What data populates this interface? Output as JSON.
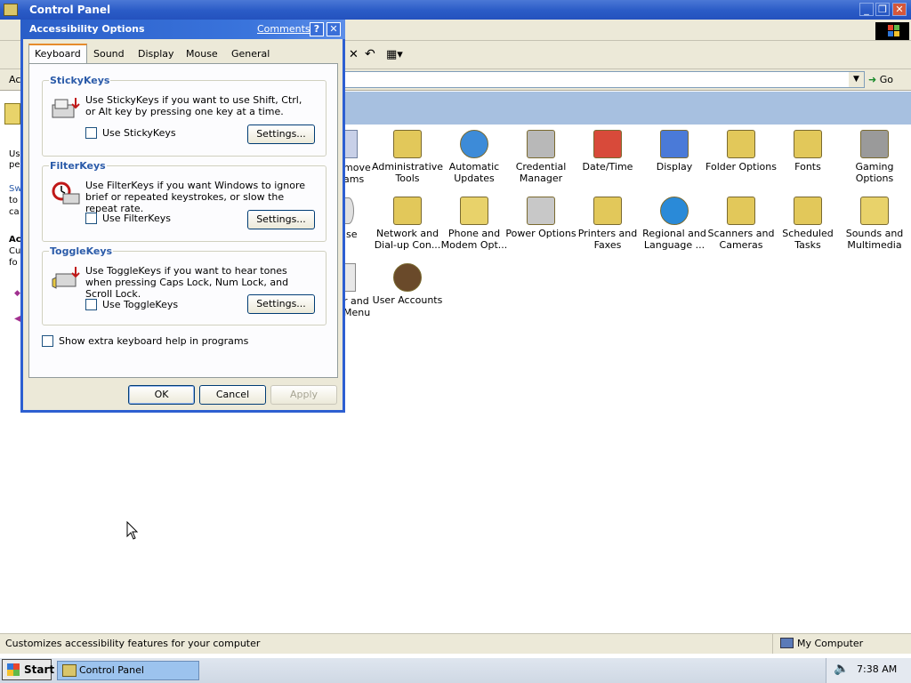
{
  "window": {
    "title": "Control Panel",
    "minimize": "_",
    "restore": "❐",
    "close": "✕"
  },
  "address": {
    "label": "Ac",
    "go": "Go",
    "dropdown": "▼"
  },
  "left_pane": {
    "lines": [
      "Us",
      "pe",
      "Sw",
      "to",
      "ca",
      "Ac",
      "Cu",
      "fo"
    ]
  },
  "partial_icons": {
    "row1": [
      "move",
      "ams"
    ],
    "row2": "se",
    "row3": [
      "r and",
      "Menu"
    ]
  },
  "icons": [
    {
      "label": "Administrative Tools",
      "icon": "admin-tools-icon"
    },
    {
      "label": "Automatic Updates",
      "icon": "globe-update-icon"
    },
    {
      "label": "Credential Manager",
      "icon": "keys-icon"
    },
    {
      "label": "Date/Time",
      "icon": "calendar-clock-icon"
    },
    {
      "label": "Display",
      "icon": "monitor-icon"
    },
    {
      "label": "Folder Options",
      "icon": "folder-options-icon"
    },
    {
      "label": "Fonts",
      "icon": "fonts-folder-icon"
    },
    {
      "label": "Gaming Options",
      "icon": "joystick-icon"
    },
    {
      "label": "Network and Dial-up Con...",
      "icon": "network-icon"
    },
    {
      "label": "Phone and Modem Opt...",
      "icon": "phone-icon"
    },
    {
      "label": "Power Options",
      "icon": "power-plug-icon"
    },
    {
      "label": "Printers and Faxes",
      "icon": "printer-folder-icon"
    },
    {
      "label": "Regional and Language ...",
      "icon": "globe-icon"
    },
    {
      "label": "Scanners and Cameras",
      "icon": "scanner-folder-icon"
    },
    {
      "label": "Scheduled Tasks",
      "icon": "tasks-folder-icon"
    },
    {
      "label": "Sounds and Multimedia",
      "icon": "speaker-icon"
    },
    {
      "label": "User Accounts",
      "icon": "user-icon"
    }
  ],
  "dialog": {
    "title": "Accessibility Options",
    "comments_link": "Comments?",
    "help": "?",
    "close": "✕",
    "tabs": [
      "Keyboard",
      "Sound",
      "Display",
      "Mouse",
      "General"
    ],
    "active_tab": "Keyboard",
    "groups": [
      {
        "label": "StickyKeys",
        "description": "Use StickyKeys if you want to use Shift, Ctrl, or Alt key by pressing one key at a time.",
        "checkbox": "Use StickyKeys",
        "checked": false,
        "settings": "Settings..."
      },
      {
        "label": "FilterKeys",
        "description": "Use FilterKeys if you want Windows to ignore brief or repeated keystrokes, or slow the repeat rate.",
        "checkbox": "Use FilterKeys",
        "checked": false,
        "settings": "Settings..."
      },
      {
        "label": "ToggleKeys",
        "description": "Use ToggleKeys if you want to hear tones when pressing Caps Lock, Num Lock, and Scroll Lock.",
        "checkbox": "Use ToggleKeys",
        "checked": false,
        "settings": "Settings..."
      }
    ],
    "extra_help": "Show extra keyboard help in programs",
    "buttons": {
      "ok": "OK",
      "cancel": "Cancel",
      "apply": "Apply"
    }
  },
  "status": {
    "text": "Customizes accessibility features for your computer",
    "zone": "My Computer"
  },
  "taskbar": {
    "start": "Start",
    "item": "Control Panel",
    "clock": "7:38 AM"
  },
  "colors": {
    "title_blue": "#2a5bc6",
    "header_band": "#a7c0e0",
    "dialog_bg": "#ece9d8",
    "group_label": "#2b5ba9"
  }
}
